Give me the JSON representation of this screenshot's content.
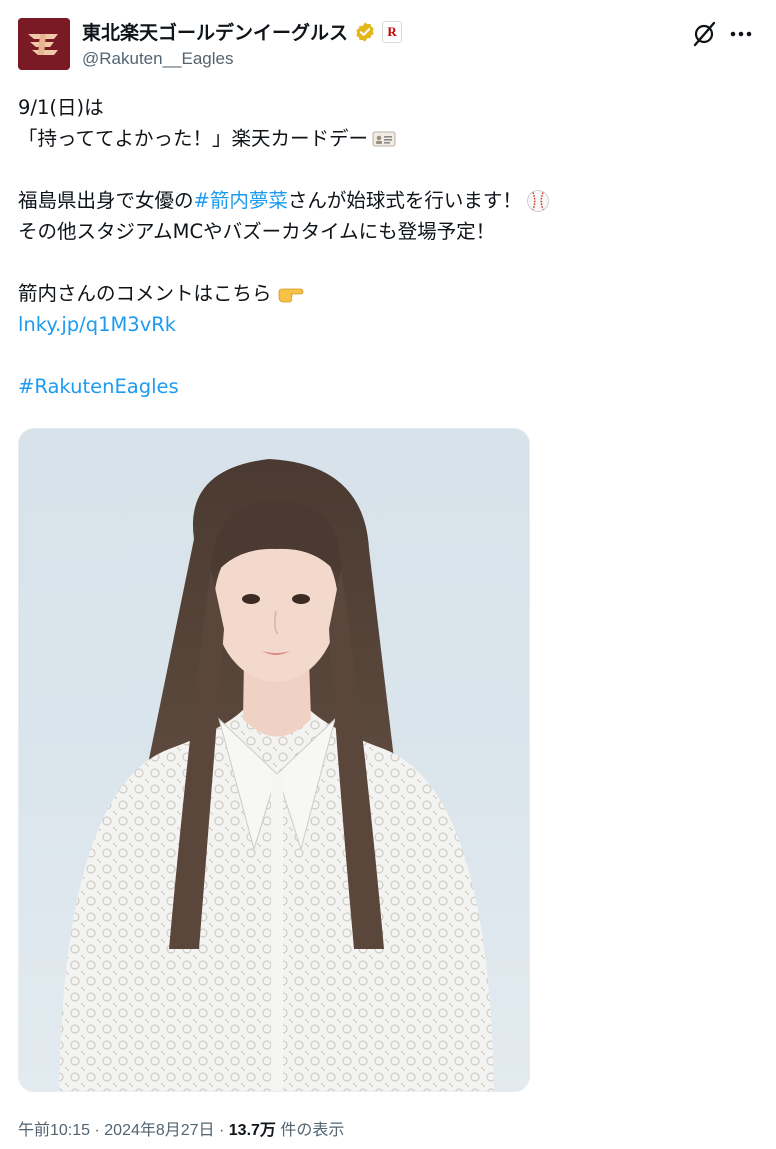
{
  "account": {
    "display_name": "東北楽天ゴールデンイーグルス",
    "handle": "@Rakuten__Eagles",
    "affiliate_badge": "R"
  },
  "post": {
    "line1": "9/1(日)は",
    "line2": "「持っててよかった！」楽天カードデー",
    "line3_pre": "福島県出身で女優の ",
    "line3_tag": "#箭内夢菜",
    "line3_post": " さんが始球式を行います！",
    "line4": "その他スタジアムMCやバズーカタイムにも登場予定！",
    "line5": "箭内さんのコメントはこちら",
    "link": "lnky.jp/q1M3vRk",
    "hashtag": "#RakutenEagles"
  },
  "meta": {
    "time": "午前10:15",
    "sep1": " · ",
    "date": "2024年8月27日",
    "sep2": " · ",
    "views": "13.7万",
    "views_label": " 件の表示"
  },
  "icons": {
    "verified": "verified-badge-icon",
    "grok": "grok-icon",
    "more": "more-options-icon",
    "card_emoji": "id-card-emoji",
    "baseball_emoji": "baseball-emoji",
    "pointing_emoji": "pointing-right-emoji"
  },
  "colors": {
    "link": "#1d9bf0",
    "secondary": "#536471",
    "brand": "#7a1a24",
    "verified": "#e2b719"
  }
}
